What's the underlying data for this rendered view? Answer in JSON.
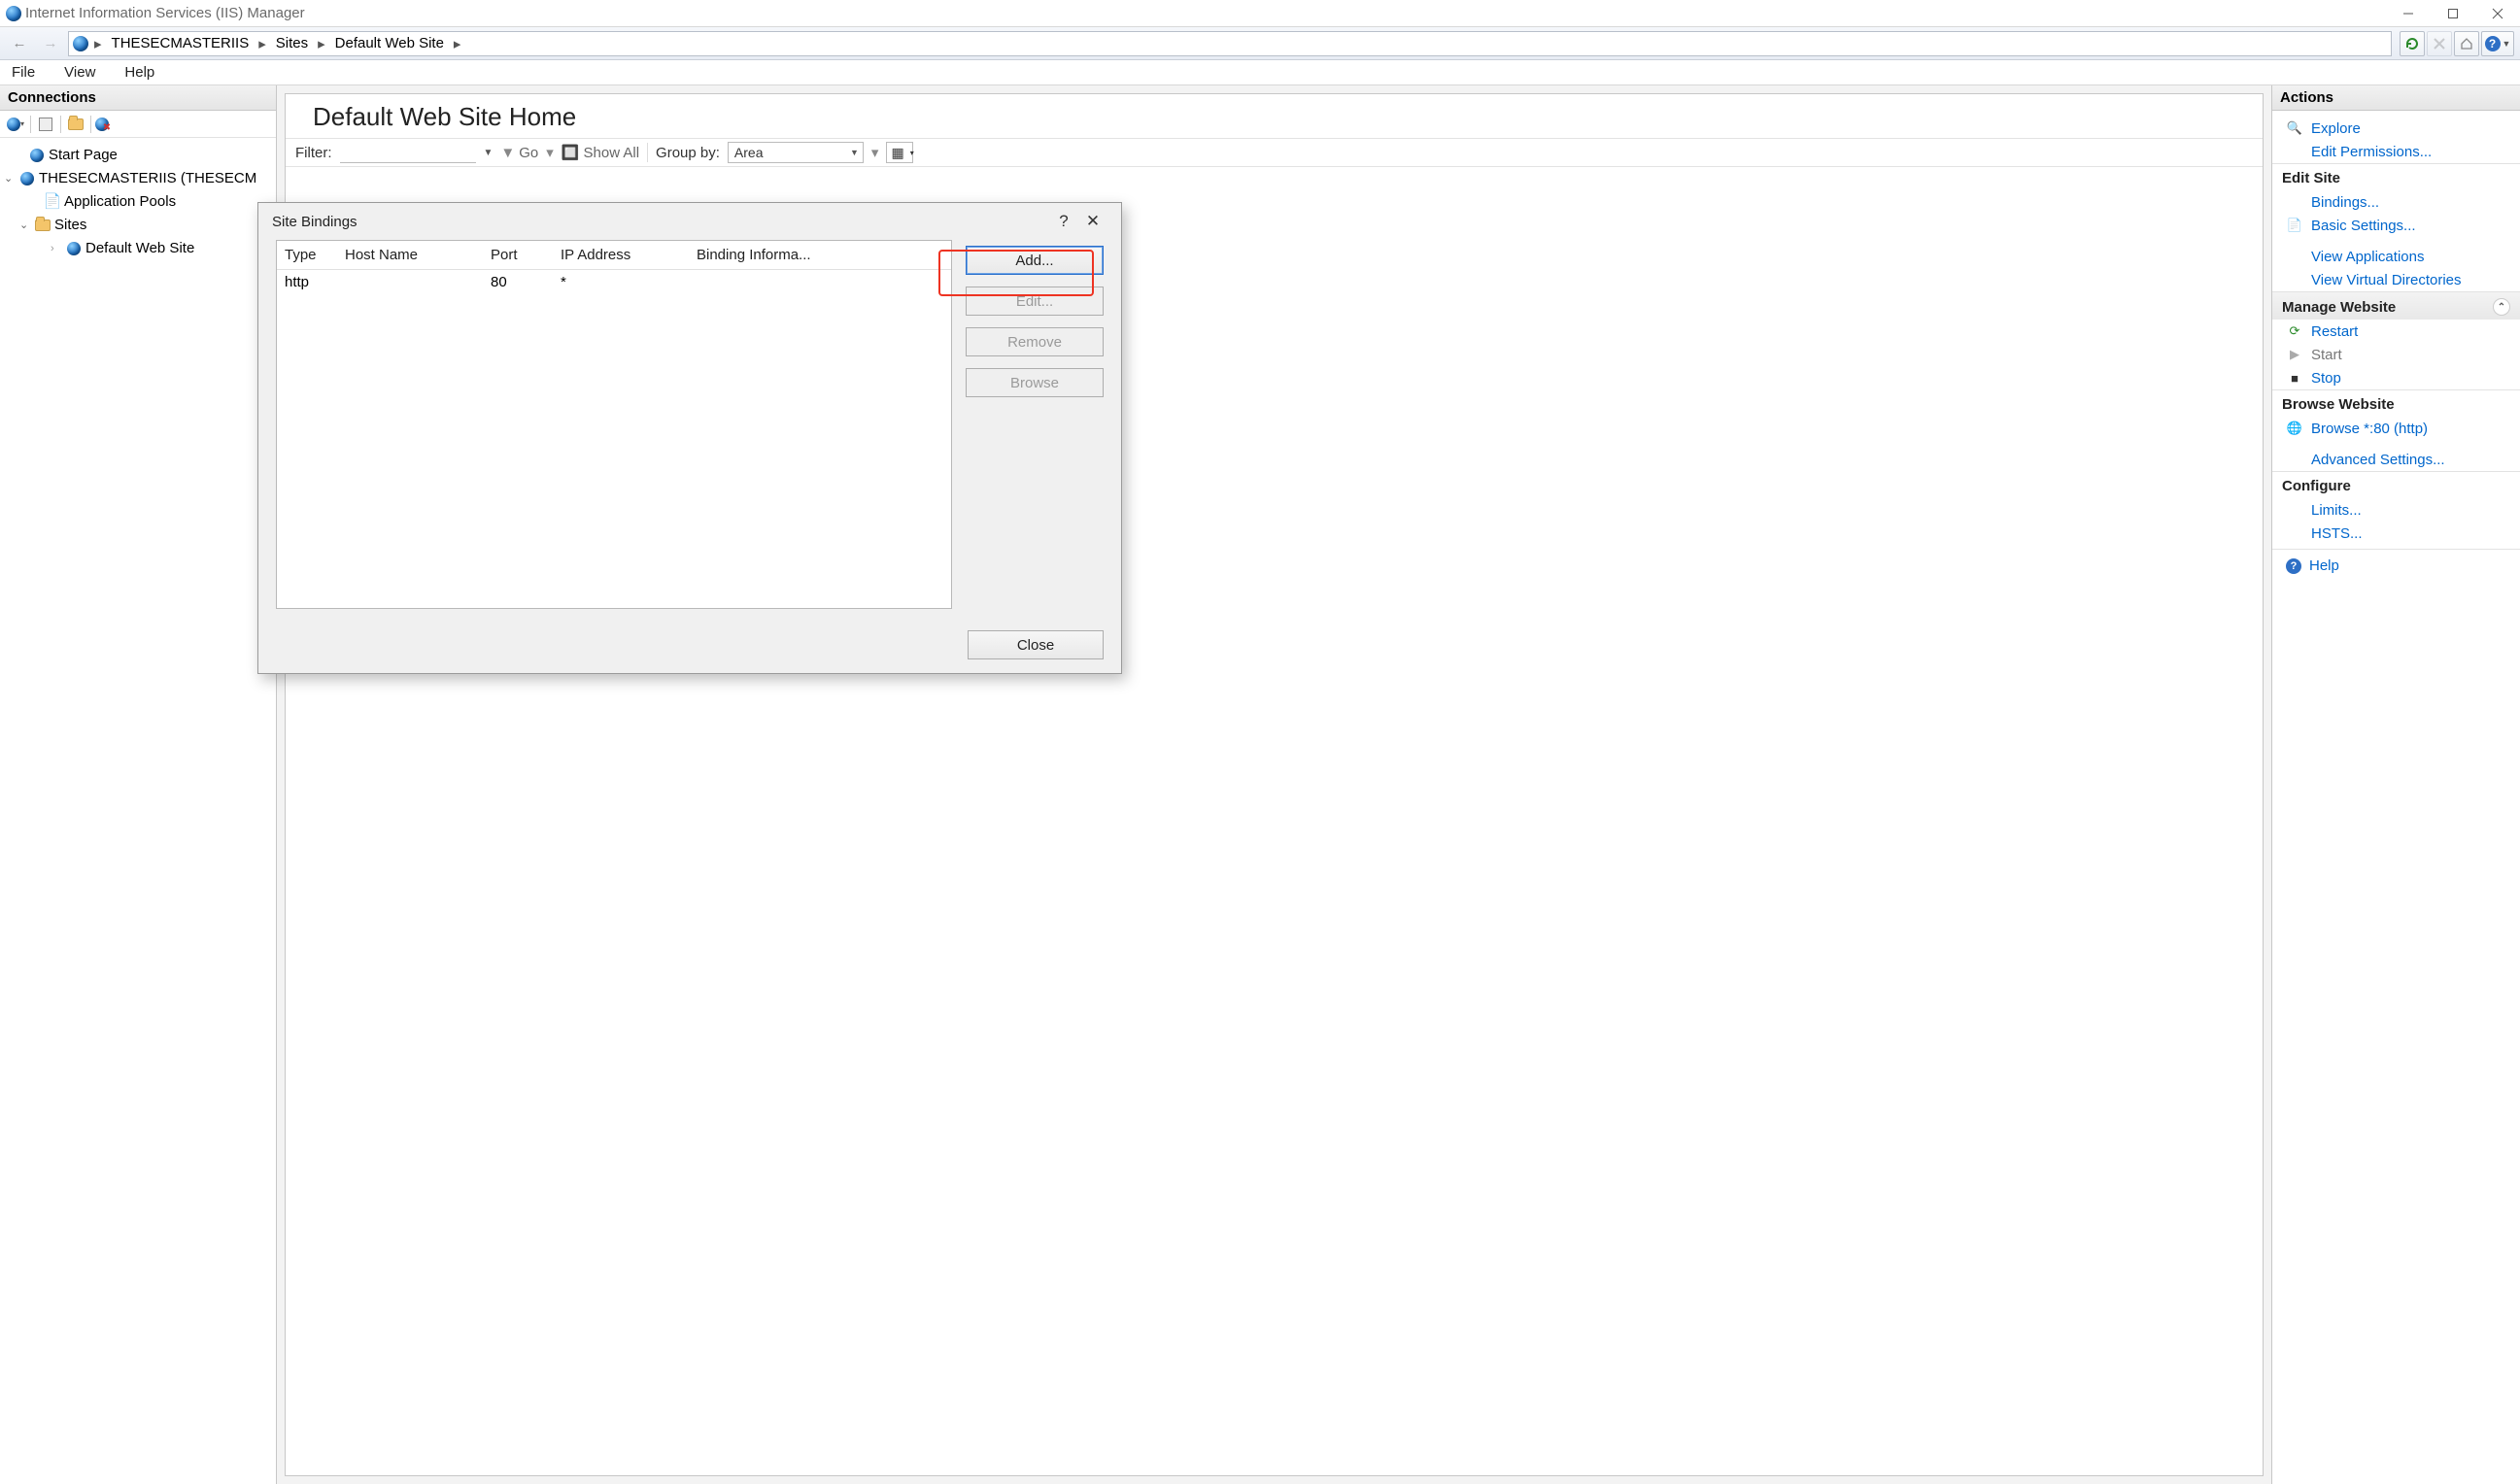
{
  "window": {
    "title": "Internet Information Services (IIS) Manager"
  },
  "breadcrumb": {
    "server": "THESECMASTERIIS",
    "sites": "Sites",
    "site": "Default Web Site"
  },
  "menu": {
    "file": "File",
    "view": "View",
    "help": "Help"
  },
  "connections": {
    "header": "Connections",
    "tree": {
      "start_page": "Start Page",
      "server": "THESECMASTERIIS (THESECM",
      "app_pools": "Application Pools",
      "sites": "Sites",
      "default_site": "Default Web Site"
    }
  },
  "center": {
    "title": "Default Web Site Home",
    "filter_label": "Filter:",
    "go": "Go",
    "show_all": "Show All",
    "group_by": "Group by:",
    "group_value": "Area"
  },
  "dialog": {
    "title": "Site Bindings",
    "columns": {
      "type": "Type",
      "host": "Host Name",
      "port": "Port",
      "ip": "IP Address",
      "info": "Binding Informa..."
    },
    "row": {
      "type": "http",
      "host": "",
      "port": "80",
      "ip": "*",
      "info": ""
    },
    "buttons": {
      "add": "Add...",
      "edit": "Edit...",
      "remove": "Remove",
      "browse": "Browse",
      "close": "Close"
    }
  },
  "actions": {
    "header": "Actions",
    "explore": "Explore",
    "edit_permissions": "Edit Permissions...",
    "edit_site": "Edit Site",
    "bindings": "Bindings...",
    "basic_settings": "Basic Settings...",
    "view_applications": "View Applications",
    "view_virtual_dirs": "View Virtual Directories",
    "manage_website": "Manage Website",
    "restart": "Restart",
    "start": "Start",
    "stop": "Stop",
    "browse_website": "Browse Website",
    "browse_80": "Browse *:80 (http)",
    "advanced_settings": "Advanced Settings...",
    "configure": "Configure",
    "limits": "Limits...",
    "hsts": "HSTS...",
    "help": "Help"
  }
}
